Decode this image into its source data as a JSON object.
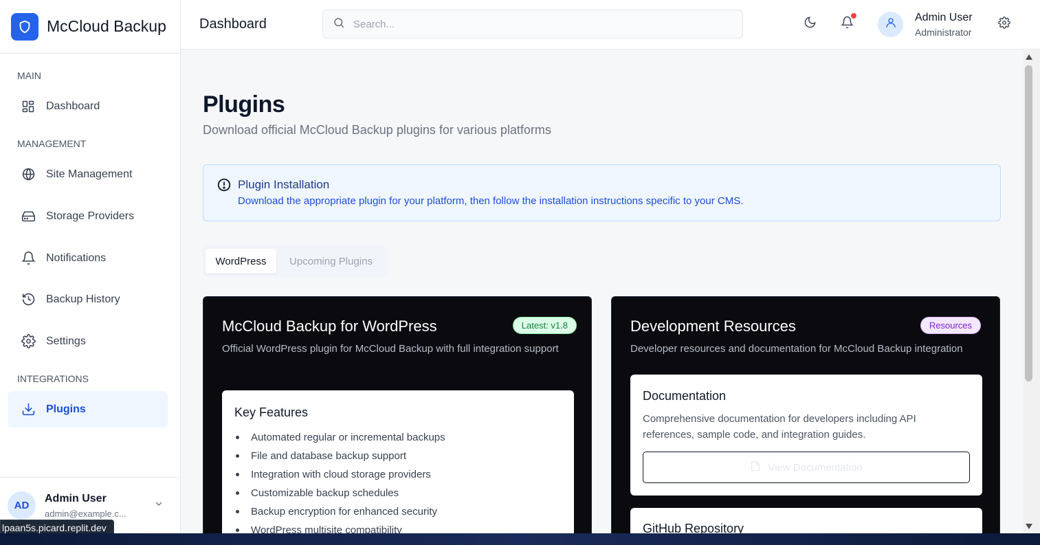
{
  "brand": {
    "name": "McCloud Backup"
  },
  "sidebar": {
    "sections": {
      "main": "MAIN",
      "management": "MANAGEMENT",
      "integrations": "INTEGRATIONS"
    },
    "items": [
      {
        "label": "Dashboard",
        "icon": "layout-grid-icon"
      },
      {
        "label": "Site Management",
        "icon": "globe-icon"
      },
      {
        "label": "Storage Providers",
        "icon": "hard-drive-icon"
      },
      {
        "label": "Notifications",
        "icon": "bell-icon"
      },
      {
        "label": "Backup History",
        "icon": "history-icon"
      },
      {
        "label": "Settings",
        "icon": "gear-icon"
      },
      {
        "label": "Plugins",
        "icon": "download-icon"
      }
    ],
    "footer": {
      "initials": "AD",
      "name": "Admin User",
      "email": "admin@example.c..."
    }
  },
  "header": {
    "title": "Dashboard",
    "search_placeholder": "Search...",
    "user": {
      "name": "Admin User",
      "role": "Administrator"
    }
  },
  "page": {
    "title": "Plugins",
    "subtitle": "Download official McCloud Backup plugins for various platforms",
    "alert": {
      "title": "Plugin Installation",
      "text": "Download the appropriate plugin for your platform, then follow the installation instructions specific to your CMS."
    },
    "tabs": [
      {
        "label": "WordPress",
        "active": true
      },
      {
        "label": "Upcoming Plugins",
        "active": false
      }
    ],
    "wordpress_card": {
      "title": "McCloud Backup for WordPress",
      "badge": "Latest: v1.8",
      "description": "Official WordPress plugin for McCloud Backup with full integration support",
      "features_title": "Key Features",
      "features": [
        "Automated regular or incremental backups",
        "File and database backup support",
        "Integration with cloud storage providers",
        "Customizable backup schedules",
        "Backup encryption for enhanced security",
        "WordPress multisite compatibility"
      ]
    },
    "resources_card": {
      "title": "Development Resources",
      "badge": "Resources",
      "description": "Developer resources and documentation for McCloud Backup integration",
      "documentation": {
        "title": "Documentation",
        "text": "Comprehensive documentation for developers including API references, sample code, and integration guides.",
        "button": "View Documentation"
      },
      "github": {
        "title": "GitHub Repository"
      }
    }
  },
  "status_bar": {
    "url": "lpaan5s.picard.replit.dev"
  },
  "colors": {
    "accent": "#2563eb",
    "card_bg": "#0b0b0f",
    "alert_bg": "#eff6ff",
    "notification_dot": "#ef4444"
  }
}
